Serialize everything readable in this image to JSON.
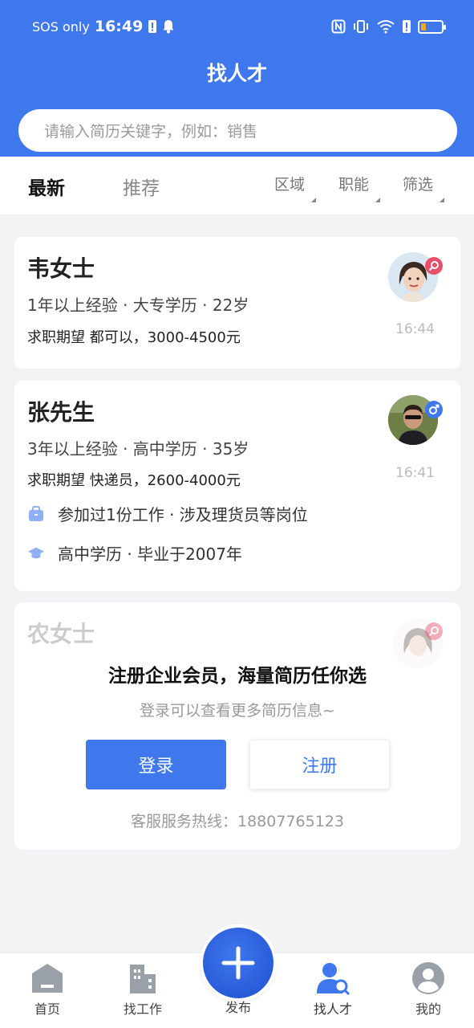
{
  "status_bar": {
    "carrier": "SOS only",
    "time": "16:49"
  },
  "header": {
    "title": "找人才"
  },
  "search": {
    "placeholder": "请输入简历关键字，例如：销售"
  },
  "tabs": [
    {
      "label": "最新",
      "active": true
    },
    {
      "label": "推荐",
      "active": false
    }
  ],
  "filters": [
    {
      "label": "区域"
    },
    {
      "label": "职能"
    },
    {
      "label": "筛选"
    }
  ],
  "candidates": [
    {
      "name": "韦女士",
      "meta": "1年以上经验 · 大专学历 · 22岁",
      "expectation": "求职期望 都可以，3000-4500元",
      "time": "16:44",
      "gender": "female"
    },
    {
      "name": "张先生",
      "meta": "3年以上经验 · 高中学历 · 35岁",
      "expectation": "求职期望 快递员，2600-4000元",
      "time": "16:41",
      "gender": "male",
      "work_detail": "参加过1份工作 · 涉及理货员等岗位",
      "edu_detail": "高中学历 · 毕业于2007年"
    },
    {
      "name": "农女士",
      "gender": "female"
    }
  ],
  "promo": {
    "title": "注册企业会员，海量简历任你选",
    "subtitle": "登录可以查看更多简历信息~",
    "login_label": "登录",
    "register_label": "注册",
    "hotline": "客服服务热线：18807765123"
  },
  "bottom_nav": {
    "items": [
      {
        "label": "首页"
      },
      {
        "label": "找工作"
      },
      {
        "label": "发布"
      },
      {
        "label": "找人才",
        "active": true
      },
      {
        "label": "我的"
      }
    ]
  },
  "colors": {
    "primary": "#3f78ec",
    "female_badge": "#e8506a",
    "male_badge": "#3f78ec"
  }
}
